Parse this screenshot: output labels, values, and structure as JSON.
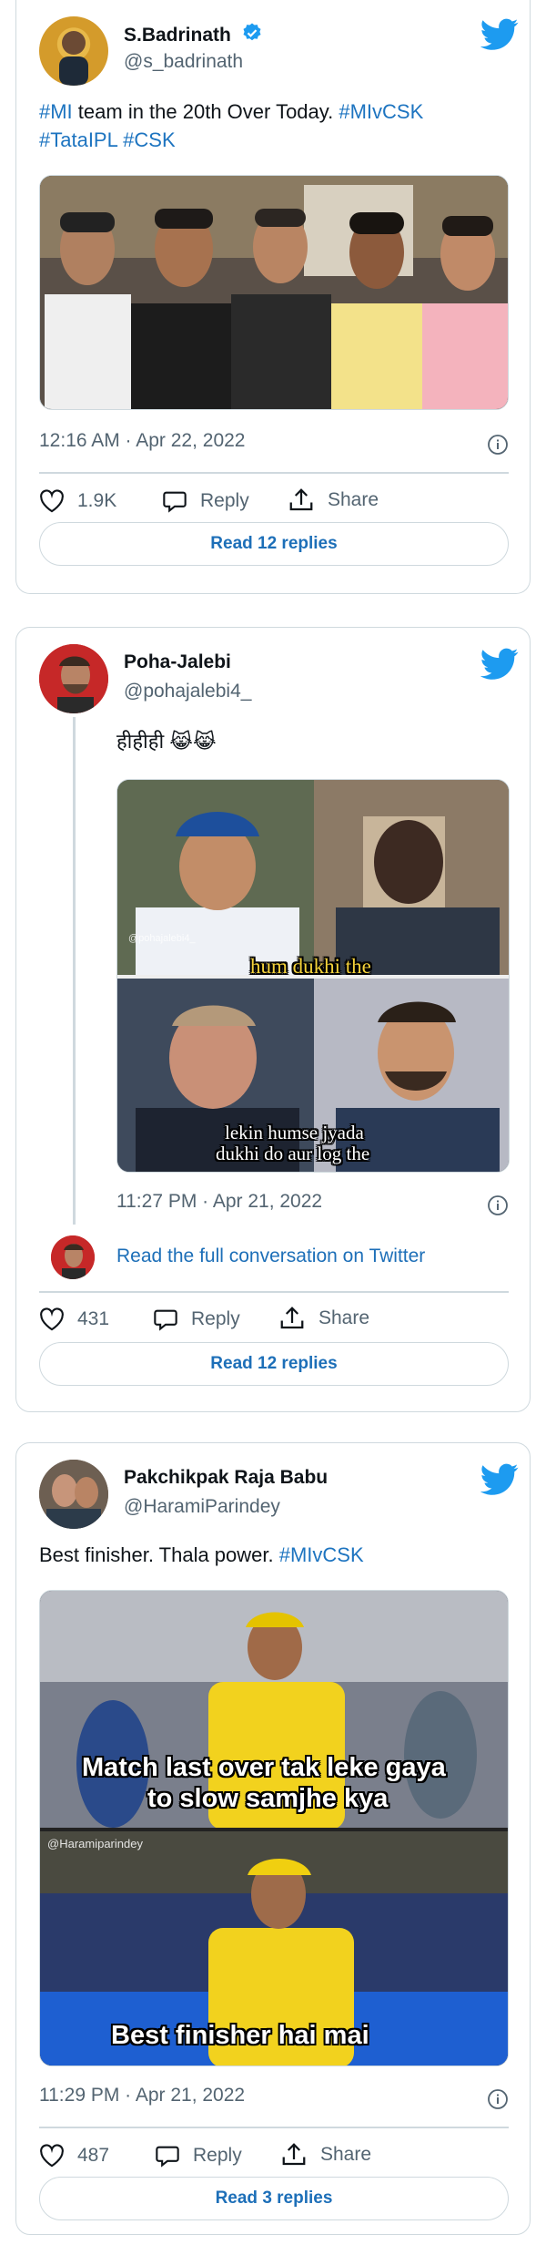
{
  "tweets": [
    {
      "name": "S.Badrinath",
      "handle": "@s_badrinath",
      "verified": true,
      "text_parts": [
        "#MI",
        " team in the 20th Over Today. ",
        "#MIvCSK",
        "#TataIPL",
        " ",
        "#CSK"
      ],
      "timestamp": "12:16 AM · Apr 22, 2022",
      "likes": "1.9K",
      "reply_label": "Reply",
      "share_label": "Share",
      "read_replies": "Read 12 replies"
    },
    {
      "name": "Poha-Jalebi",
      "handle": "@pohajalebi4_",
      "verified": false,
      "quoted_text": "हीहीही 😹😹",
      "meme_watermark": "@pohajalebi4_",
      "meme_caption_top": "hum dukhi the",
      "meme_caption_bottom_1": "lekin humse jyada",
      "meme_caption_bottom_2": "dukhi do aur log the",
      "timestamp": "11:27 PM · Apr 21, 2022",
      "conversation_link": "Read the full conversation on Twitter",
      "likes": "431",
      "reply_label": "Reply",
      "share_label": "Share",
      "read_replies": "Read 12 replies"
    },
    {
      "name": "Pakchikpak Raja Babu",
      "handle": "@HaramiParindey",
      "verified": false,
      "text_parts": [
        "Best finisher. Thala power. ",
        "#MIvCSK"
      ],
      "meme_caption_top_1": "Match last over tak leke gaya",
      "meme_caption_top_2": "to slow samjhe kya",
      "meme_watermark": "@Haramiparindey",
      "meme_caption_bottom": "Best finisher hai mai",
      "timestamp": "11:29 PM · Apr 21, 2022",
      "likes": "487",
      "reply_label": "Reply",
      "share_label": "Share",
      "read_replies": "Read 3 replies"
    }
  ],
  "colors": {
    "link": "#1d74c0",
    "secondary_text": "#536471",
    "border": "#cfd9de",
    "twitter_blue": "#1d9bf0"
  },
  "icons": [
    "twitter-bird-icon",
    "verified-badge-icon",
    "info-icon",
    "heart-icon",
    "reply-icon",
    "share-icon"
  ]
}
